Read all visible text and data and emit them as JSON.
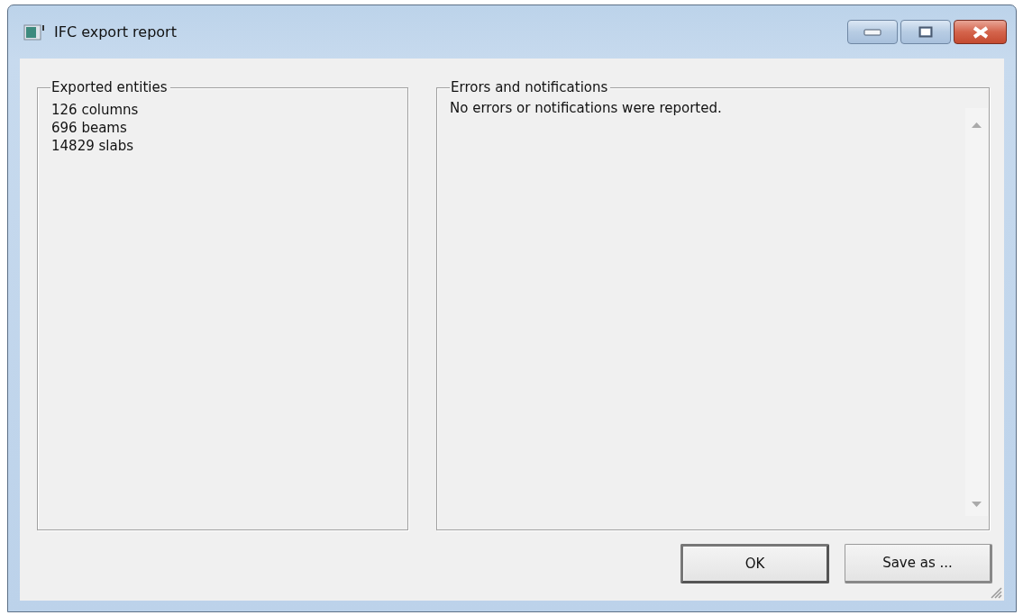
{
  "window": {
    "title": "IFC export report"
  },
  "groups": [
    {
      "kind": "list",
      "title": "Exported entities",
      "lines": [
        "126 columns",
        "696 beams",
        "14829 slabs"
      ]
    },
    {
      "kind": "textarea",
      "title": "Errors and notifications",
      "text": "No errors or notifications were reported."
    }
  ],
  "buttons": [
    {
      "label": "OK",
      "default": true
    },
    {
      "label": "Save as ...",
      "default": false
    }
  ]
}
